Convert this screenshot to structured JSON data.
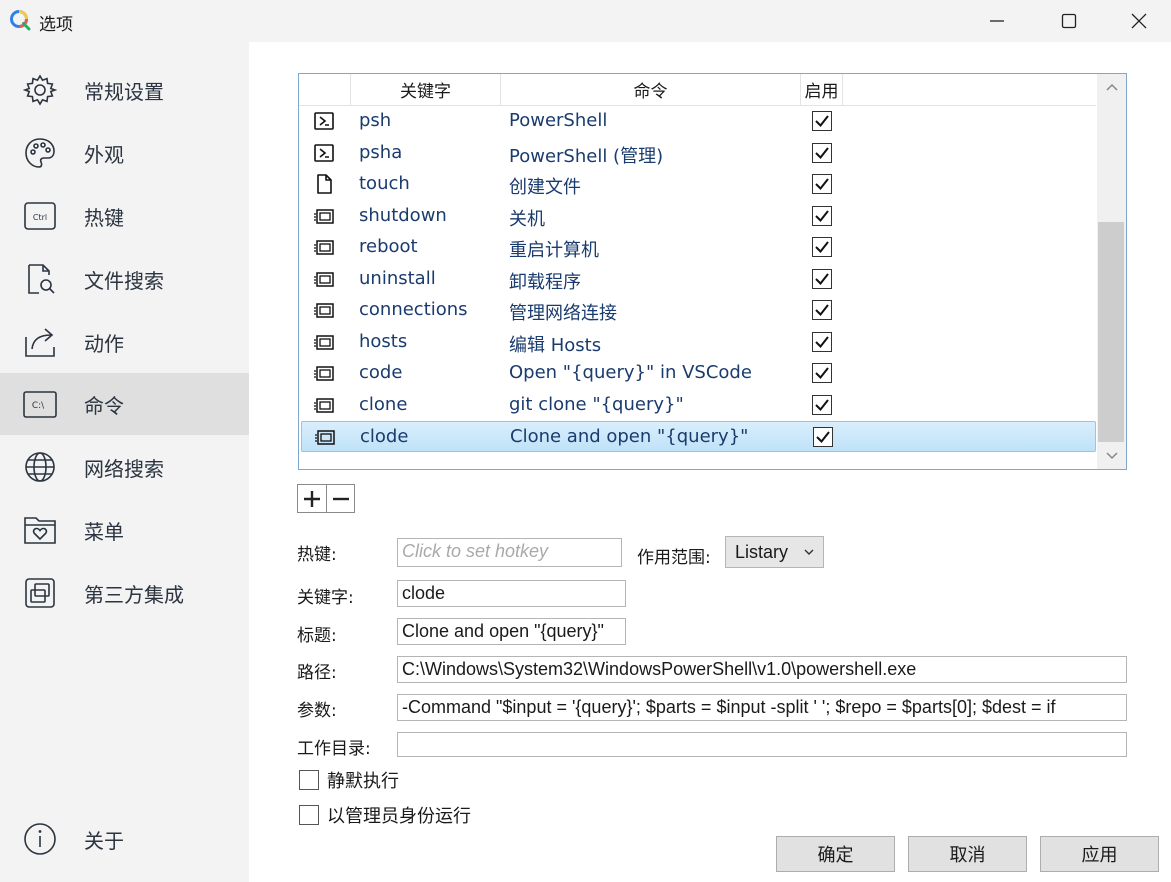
{
  "window": {
    "title": "选项",
    "controls": [
      "minimize-icon",
      "maximize-icon",
      "close-icon"
    ]
  },
  "sidebar": {
    "items": [
      {
        "label": "常规设置",
        "icon": "gear-icon"
      },
      {
        "label": "外观",
        "icon": "palette-icon"
      },
      {
        "label": "热键",
        "icon": "ctrl-key-icon",
        "icon_text": "Ctrl"
      },
      {
        "label": "文件搜索",
        "icon": "file-search-icon"
      },
      {
        "label": "动作",
        "icon": "share-arrow-icon"
      },
      {
        "label": "命令",
        "icon": "terminal-icon",
        "icon_text": "C:\\",
        "active": true
      },
      {
        "label": "网络搜索",
        "icon": "globe-icon"
      },
      {
        "label": "菜单",
        "icon": "folder-heart-icon"
      },
      {
        "label": "第三方集成",
        "icon": "integration-icon"
      }
    ],
    "footer": {
      "label": "关于",
      "icon": "info-icon"
    }
  },
  "table": {
    "columns": [
      "关键字",
      "命令",
      "启用"
    ],
    "rows": [
      {
        "icon": "powershell-icon",
        "keyword": "psh",
        "command": "PowerShell",
        "enabled": true
      },
      {
        "icon": "powershell-icon",
        "keyword": "psha",
        "command": "PowerShell (管理)",
        "enabled": true
      },
      {
        "icon": "file-icon",
        "keyword": "touch",
        "command": "创建文件",
        "enabled": true
      },
      {
        "icon": "window-command-icon",
        "keyword": "shutdown",
        "command": "关机",
        "enabled": true
      },
      {
        "icon": "window-command-icon",
        "keyword": "reboot",
        "command": "重启计算机",
        "enabled": true
      },
      {
        "icon": "window-command-icon",
        "keyword": "uninstall",
        "command": "卸载程序",
        "enabled": true
      },
      {
        "icon": "window-command-icon",
        "keyword": "connections",
        "command": "管理网络连接",
        "enabled": true
      },
      {
        "icon": "window-command-icon",
        "keyword": "hosts",
        "command": "编辑 Hosts",
        "enabled": true
      },
      {
        "icon": "window-command-icon",
        "keyword": "code",
        "command": "Open \"{query}\" in VSCode",
        "enabled": true
      },
      {
        "icon": "window-command-icon",
        "keyword": "clone",
        "command": "git clone \"{query}\"",
        "enabled": true
      },
      {
        "icon": "window-command-icon",
        "keyword": "clode",
        "command": "Clone and open \"{query}\"",
        "enabled": true,
        "selected": true
      }
    ]
  },
  "toolbar": {
    "add_icon": "plus-icon",
    "remove_icon": "minus-icon"
  },
  "form": {
    "hotkey_label": "热键:",
    "hotkey_placeholder": "Click to set hotkey",
    "scope_label": "作用范围:",
    "scope_value": "Listary",
    "keyword_label": "关键字:",
    "keyword_value": "clode",
    "title_label": "标题:",
    "title_value": "Clone and open \"{query}\"",
    "path_label": "路径:",
    "path_value": "C:\\Windows\\System32\\WindowsPowerShell\\v1.0\\powershell.exe",
    "args_label": "参数:",
    "args_value": "-Command \"$input = '{query}'; $parts = $input -split ' '; $repo = $parts[0]; $dest = if",
    "workdir_label": "工作目录:",
    "workdir_value": "",
    "silent_label": "静默执行",
    "silent_checked": false,
    "admin_label": "以管理员身份运行",
    "admin_checked": false
  },
  "buttons": {
    "ok": "确定",
    "cancel": "取消",
    "apply": "应用"
  },
  "colors": {
    "selection": "#cce8fb",
    "table_border": "#7fa8cf",
    "sidebar_bg": "#f3f3f3",
    "active_nav": "#dfdfdf"
  }
}
